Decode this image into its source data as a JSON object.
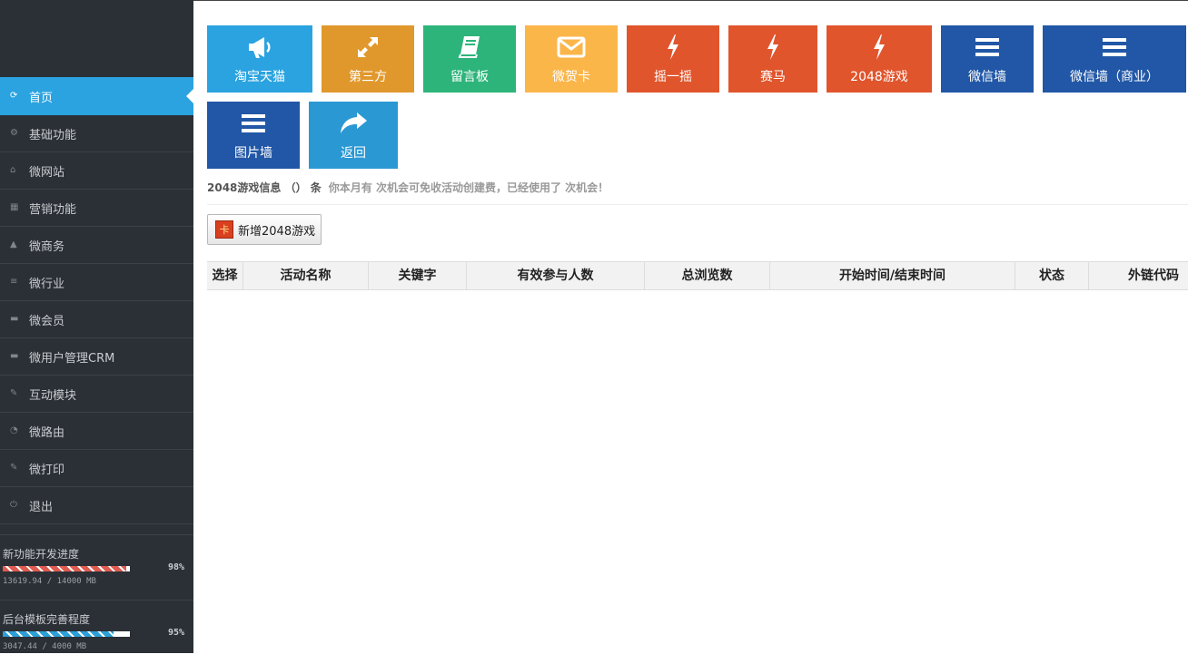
{
  "sidebar": {
    "items": [
      {
        "label": "首页",
        "icon": "refresh-icon",
        "active": true
      },
      {
        "label": "基础功能",
        "icon": "gears-icon"
      },
      {
        "label": "微网站",
        "icon": "home-icon"
      },
      {
        "label": "营销功能",
        "icon": "grid-icon"
      },
      {
        "label": "微商务",
        "icon": "sitemap-icon"
      },
      {
        "label": "微行业",
        "icon": "list-icon"
      },
      {
        "label": "微会员",
        "icon": "card-icon"
      },
      {
        "label": "微用户管理CRM",
        "icon": "card-icon"
      },
      {
        "label": "互动模块",
        "icon": "pencil-icon"
      },
      {
        "label": "微路由",
        "icon": "rss-icon"
      },
      {
        "label": "微打印",
        "icon": "pencil-icon"
      },
      {
        "label": "退出",
        "icon": "power-icon"
      }
    ],
    "progress": [
      {
        "title": "新功能开发进度",
        "percent_text": "98%",
        "percent": 0.97,
        "size_text": "13619.94 / 14000 MB",
        "color": "#e05a4f"
      },
      {
        "title": "后台模板完善程度",
        "percent_text": "95%",
        "percent": 0.87,
        "size_text": "3047.44 / 4000 MB",
        "color": "#2a9fd8"
      }
    ]
  },
  "tiles": [
    {
      "label": "淘宝天猫",
      "icon": "bullhorn-icon",
      "color": "#2aa3e0"
    },
    {
      "label": "第三方",
      "icon": "expand-icon",
      "color": "#e0982c"
    },
    {
      "label": "留言板",
      "icon": "book-icon",
      "color": "#2db47a"
    },
    {
      "label": "微贺卡",
      "icon": "envelope-icon",
      "color": "#fbb64a"
    },
    {
      "label": "摇一摇",
      "icon": "bolt-icon",
      "color": "#e0552c"
    },
    {
      "label": "赛马",
      "icon": "bolt-icon",
      "color": "#e0552c"
    },
    {
      "label": "2048游戏",
      "icon": "bolt-icon",
      "color": "#e0552c"
    },
    {
      "label": "微信墙",
      "icon": "menu-icon",
      "color": "#2157a6"
    },
    {
      "label": "微信墙（商业）",
      "icon": "menu-icon",
      "color": "#2157a6"
    },
    {
      "label": "图片墙",
      "icon": "menu-icon",
      "color": "#2157a6"
    },
    {
      "label": "返回",
      "icon": "share-icon",
      "color": "#2a98d3"
    }
  ],
  "info": {
    "title": "2048游戏信息 （） 条",
    "note": "你本月有 次机会可免收活动创建费，已经使用了 次机会！"
  },
  "add_button": {
    "icon_text": "卡",
    "label": "新增2048游戏"
  },
  "table": {
    "headers": [
      "选择",
      "活动名称",
      "关键字",
      "有效参与人数",
      "总浏览数",
      "开始时间/结束时间",
      "状态",
      "外链代码"
    ]
  }
}
